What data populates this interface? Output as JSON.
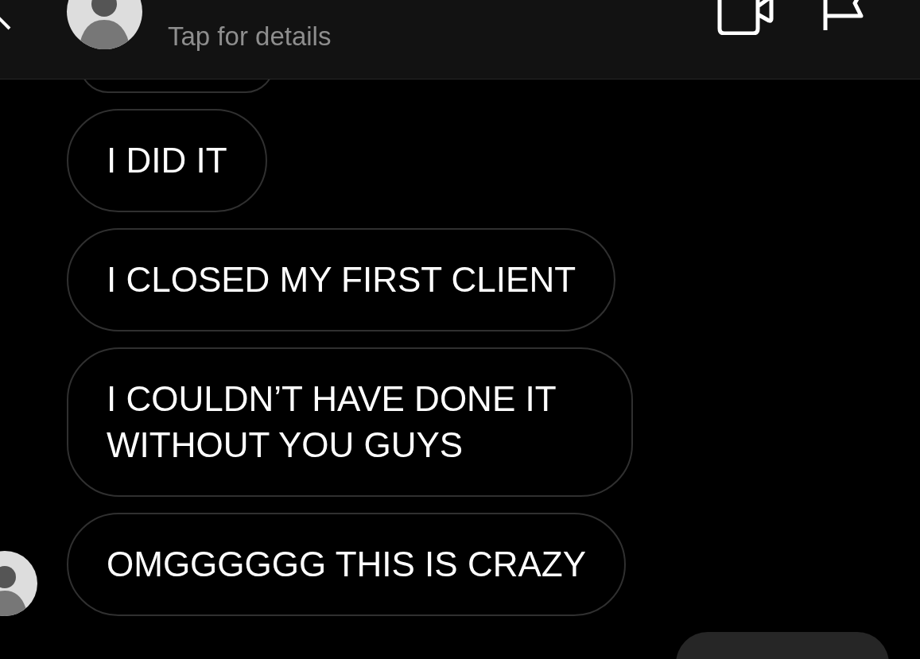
{
  "header": {
    "subtitle": "Tap for details"
  },
  "messages": [
    {
      "kind": "incoming",
      "partial": true,
      "show_avatar": false
    },
    {
      "kind": "incoming",
      "text": "I DID IT",
      "show_avatar": false
    },
    {
      "kind": "incoming",
      "text": "I CLOSED MY FIRST CLIENT",
      "show_avatar": false
    },
    {
      "kind": "incoming",
      "text": "I COULDN’T HAVE DONE IT WITHOUT YOU GUYS",
      "show_avatar": false
    },
    {
      "kind": "incoming",
      "text": "OMGGGGGG THIS IS CRAZY",
      "show_avatar": true
    },
    {
      "kind": "outgoing",
      "partial": true
    }
  ]
}
